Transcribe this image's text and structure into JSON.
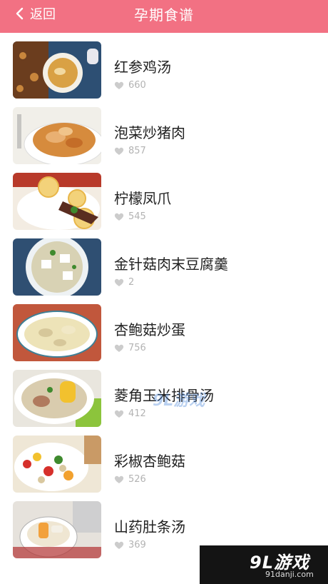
{
  "header": {
    "back_label": "返回",
    "title": "孕期食谱",
    "color": "#f27183"
  },
  "recipes": [
    {
      "name": "红参鸡汤",
      "likes": "660",
      "thumb_icon": "chicken-soup-photo"
    },
    {
      "name": "泡菜炒猪肉",
      "likes": "857",
      "thumb_icon": "kimchi-pork-photo"
    },
    {
      "name": "柠檬凤爪",
      "likes": "545",
      "thumb_icon": "lemon-chicken-feet-photo"
    },
    {
      "name": "金针菇肉末豆腐羹",
      "likes": "2",
      "thumb_icon": "tofu-soup-photo"
    },
    {
      "name": "杏鲍菇炒蛋",
      "likes": "756",
      "thumb_icon": "mushroom-egg-photo"
    },
    {
      "name": "菱角玉米排骨汤",
      "likes": "412",
      "thumb_icon": "corn-ribs-soup-photo"
    },
    {
      "name": "彩椒杏鲍菇",
      "likes": "526",
      "thumb_icon": "pepper-mushroom-photo"
    },
    {
      "name": "山药肚条汤",
      "likes": "369",
      "thumb_icon": "yam-tripe-soup-photo"
    }
  ],
  "watermark_text": "9L游戏",
  "brand": {
    "logo": "9L游戏",
    "url": "91danji.com"
  }
}
